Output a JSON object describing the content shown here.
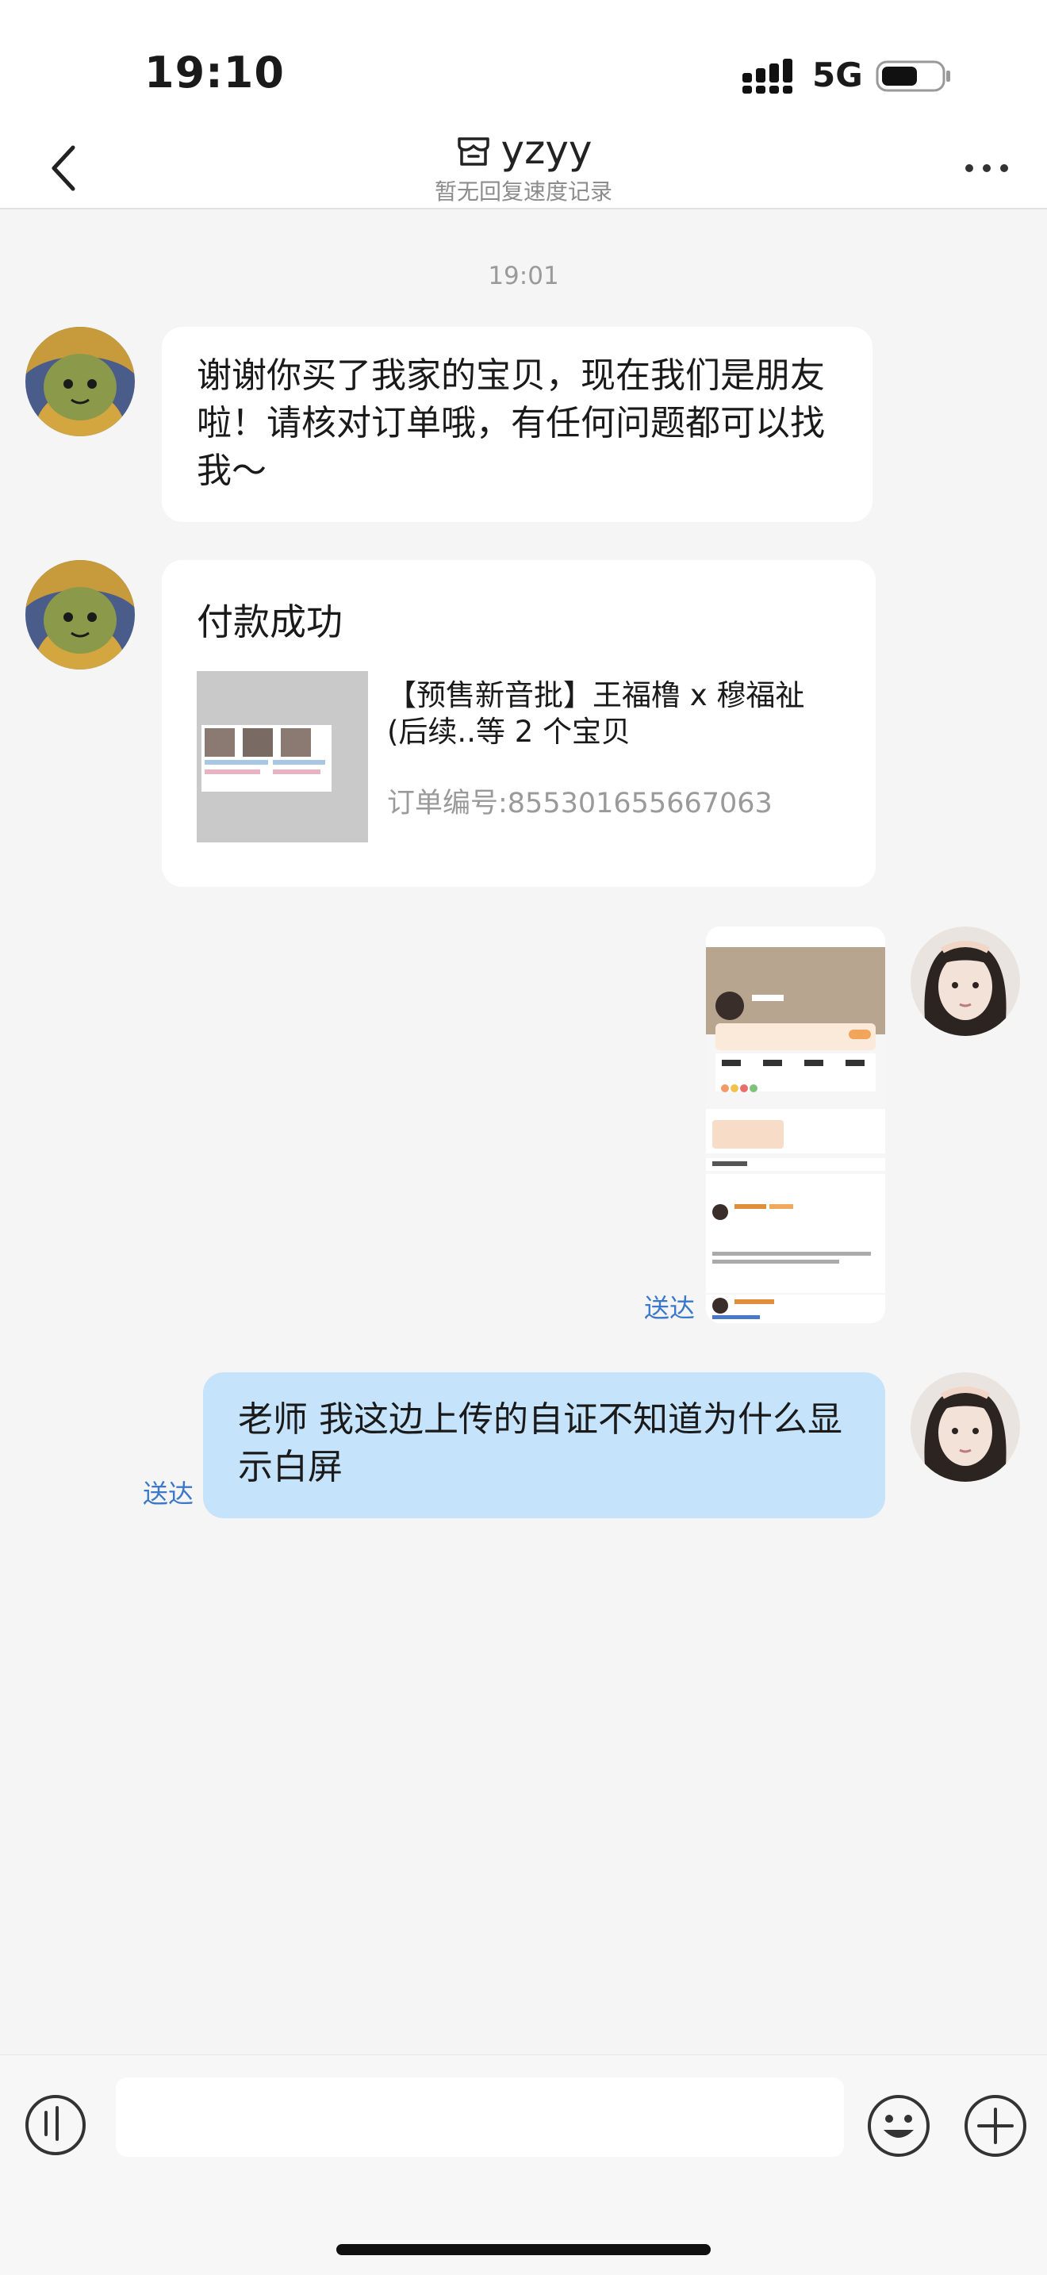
{
  "status_bar": {
    "time": "19:10",
    "network": "5G"
  },
  "header": {
    "title": "yzyy",
    "subtitle": "暂无回复速度记录"
  },
  "chat": {
    "timestamp": "19:01",
    "messages": [
      {
        "from": "seller",
        "text": "谢谢你买了我家的宝贝，现在我们是朋友啦！请核对订单哦，有任何问题都可以找我～"
      },
      {
        "from": "seller",
        "card": {
          "title": "付款成功",
          "product": "【预售新音批】王福橹 x 穆福祉(后续..等 2 个宝贝",
          "order_label": "订单编号:855301655667063"
        }
      },
      {
        "from": "me",
        "image": "screenshot",
        "status": "送达"
      },
      {
        "from": "me",
        "text": "老师 我这边上传的自证不知道为什么显示白屏",
        "status": "送达"
      }
    ]
  },
  "input_bar": {
    "placeholder": ""
  },
  "icons": {
    "back": "chevron-left-icon",
    "shop": "shop-icon",
    "more": "more-icon",
    "voice": "voice-icon",
    "emoji": "emoji-icon",
    "plus": "plus-icon"
  },
  "colors": {
    "outgoing_bubble": "#c5e3fb",
    "delivered": "#3b78c9",
    "background": "#f5f5f5"
  }
}
